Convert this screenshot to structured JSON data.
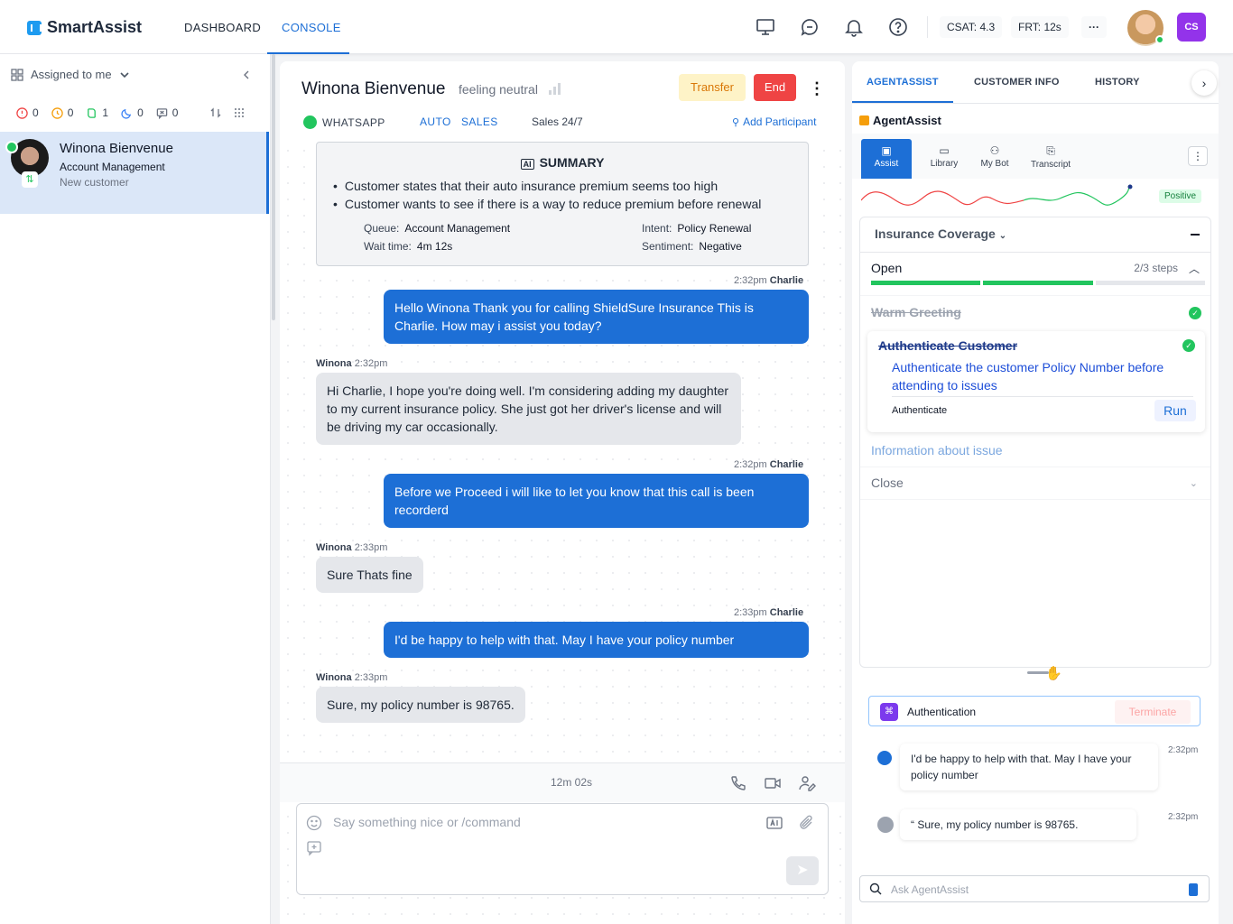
{
  "app": {
    "name": "SmartAssist"
  },
  "nav": {
    "tabs": [
      {
        "label": "DASHBOARD"
      },
      {
        "label": "CONSOLE",
        "active": true
      }
    ]
  },
  "topbar": {
    "csat": "CSAT: 4.3",
    "frt": "FRT: 12s",
    "more": "···",
    "user_initials": "CS"
  },
  "queue": {
    "filter_label": "Assigned to me",
    "counts": [
      {
        "icon": "alert-circle-icon",
        "value": "0"
      },
      {
        "icon": "clock-icon",
        "value": "0"
      },
      {
        "icon": "transfer-icon",
        "value": "1"
      },
      {
        "icon": "moon-icon",
        "value": "0"
      },
      {
        "icon": "message-x-icon",
        "value": "0"
      }
    ],
    "conversations": [
      {
        "name": "Winona Bienvenue",
        "queue": "Account Management",
        "subtitle": "New customer",
        "channel": "whatsapp"
      }
    ]
  },
  "chat": {
    "customer_name": "Winona Bienvenue",
    "sentiment": "feeling neutral",
    "transfer_label": "Transfer",
    "end_label": "End",
    "channel": "WHATSAPP",
    "tags": [
      "AUTO",
      "SALES"
    ],
    "queue_hours": "Sales 24/7",
    "add_participant": "Add Participant",
    "summary": {
      "title": "SUMMARY",
      "points": [
        "Customer states that their auto insurance premium seems too high",
        "Customer wants to see if there is a way to reduce premium before renewal"
      ],
      "queue_label": "Queue:",
      "queue_value": "Account Management",
      "wait_label": "Wait time:",
      "wait_value": "4m 12s",
      "intent_label": "Intent:",
      "intent_value": "Policy Renewal",
      "sentiment_label": "Sentiment:",
      "sentiment_value": "Negative"
    },
    "messages": [
      {
        "from": "agent",
        "sender": "Charlie",
        "time": "2:32pm",
        "text": "Hello Winona Thank you for calling ShieldSure Insurance This is Charlie. How may i assist you today?"
      },
      {
        "from": "customer",
        "sender": "Winona",
        "time": "2:32pm",
        "text": "Hi Charlie, I hope you're doing well. I'm considering adding my daughter to my current insurance policy. She just got her driver's license and will be driving my car occasionally."
      },
      {
        "from": "agent",
        "sender": "Charlie",
        "time": "2:32pm",
        "text": "Before we Proceed i will like to let you know that this call is been recorderd"
      },
      {
        "from": "customer",
        "sender": "Winona",
        "time": "2:33pm",
        "text": "Sure Thats fine"
      },
      {
        "from": "agent",
        "sender": "Charlie",
        "time": "2:33pm",
        "text": "I'd be happy to help with that. May I have your policy number"
      },
      {
        "from": "customer",
        "sender": "Winona",
        "time": "2:33pm",
        "text": "Sure, my policy number is 98765."
      }
    ],
    "timer": "12m 02s",
    "composer_placeholder": "Say something nice or /command"
  },
  "right": {
    "tabs": [
      {
        "label": "AGENTASSIST",
        "active": true
      },
      {
        "label": "CUSTOMER INFO"
      },
      {
        "label": "HISTORY"
      }
    ],
    "title": "AgentAssist",
    "subtabs": [
      {
        "label": "Assist",
        "active": true
      },
      {
        "label": "Library"
      },
      {
        "label": "My Bot"
      },
      {
        "label": "Transcript"
      }
    ],
    "sentiment_badge": "Positive",
    "flow": {
      "title": "Insurance Coverage",
      "status": "Open",
      "steps_label": "2/3 steps",
      "progress_done": 2,
      "progress_total": 3,
      "steps": [
        {
          "title": "Warm Greeting",
          "done": true
        },
        {
          "title": "Authenticate Customer",
          "done": true,
          "description": "Authenticate the customer Policy Number before attending to issues",
          "action_label": "Authenticate",
          "run_label": "Run"
        },
        {
          "title": "Information about issue"
        },
        {
          "title": "Close"
        }
      ]
    },
    "automation": {
      "name": "Authentication",
      "terminate_label": "Terminate"
    },
    "transcript": [
      {
        "from": "bot",
        "text": "I'd be happy to help with that. May I have your policy number",
        "time": "2:32pm"
      },
      {
        "from": "user",
        "text": "“ Sure, my policy number is 98765.",
        "time": "2:32pm"
      }
    ],
    "ask_placeholder": "Ask AgentAssist",
    "colors": {
      "accent": "#1d6fd6",
      "success": "#22c55e",
      "danger": "#ef4444",
      "warning": "#d97706"
    }
  }
}
